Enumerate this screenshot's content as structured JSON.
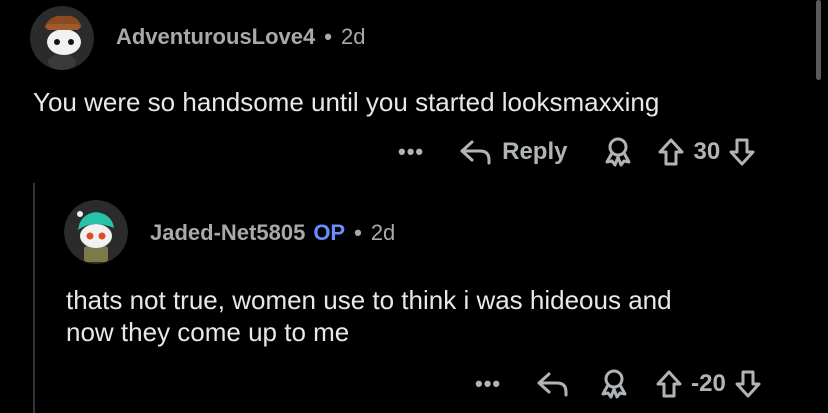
{
  "comment": {
    "username": "AdventurousLove4",
    "separator": "•",
    "age": "2d",
    "text": "You were so handsome until you started looksmaxxing",
    "actions": {
      "more_label": "•••",
      "reply_label": "Reply",
      "vote_count": "30"
    }
  },
  "reply": {
    "username": "Jaded-Net5805",
    "op_badge": "OP",
    "separator": "•",
    "age": "2d",
    "text_line1": "thats not true, women use to think i was hideous and",
    "text_line2": "now they come up to me",
    "actions": {
      "more_label": "•••",
      "vote_count": "-20"
    }
  },
  "colors": {
    "background": "#000000",
    "username": "#a7a9ab",
    "op_badge": "#6b8cff",
    "body_text": "#e6e8ea",
    "action": "#b1b4b6"
  },
  "icons": [
    "reply-arrow-icon",
    "award-icon",
    "upvote-arrow-icon",
    "downvote-arrow-icon",
    "more-options-icon"
  ]
}
